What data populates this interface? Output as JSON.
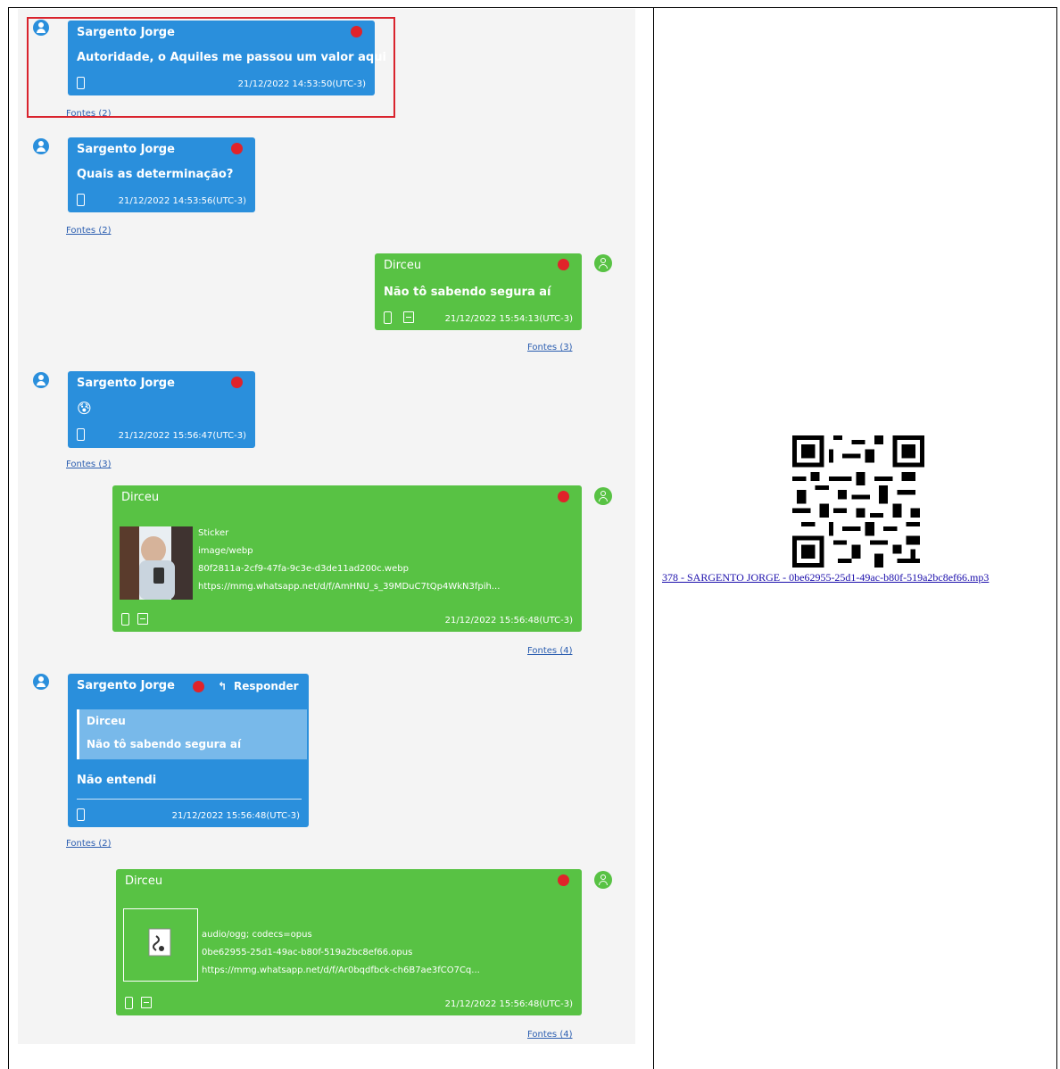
{
  "messages": [
    {
      "sender": "Sargento Jorge",
      "text": "Autoridade, o Aquiles me passou um valor aqui",
      "timestamp": "21/12/2022 14:53:50(UTC-3)",
      "sources": "Fontes (2)"
    },
    {
      "sender": "Sargento Jorge",
      "text": "Quais as determinação?",
      "timestamp": "21/12/2022 14:53:56(UTC-3)",
      "sources": "Fontes (2)"
    },
    {
      "sender": "Dirceu",
      "text": "Não tô sabendo segura aí",
      "timestamp": "21/12/2022 15:54:13(UTC-3)",
      "sources": "Fontes (3)"
    },
    {
      "sender": "Sargento Jorge",
      "text": "😰",
      "timestamp": "21/12/2022 15:56:47(UTC-3)",
      "sources": "Fontes (3)"
    },
    {
      "sender": "Dirceu",
      "file_type": "Sticker",
      "mime": "image/webp",
      "filename": "80f2811a-2cf9-47fa-9c3e-d3de11ad200c.webp",
      "url": "https://mmg.whatsapp.net/d/f/AmHNU_s_39MDuC7tQp4WkN3fpih...",
      "timestamp": "21/12/2022 15:56:48(UTC-3)",
      "sources": "Fontes (4)"
    },
    {
      "sender": "Sargento Jorge",
      "reply_label": "Responder",
      "quote_sender": "Dirceu",
      "quote_text": "Não tô sabendo segura aí",
      "text": "Não entendi",
      "timestamp": "21/12/2022 15:56:48(UTC-3)",
      "sources": "Fontes (2)"
    },
    {
      "sender": "Dirceu",
      "mime": "audio/ogg; codecs=opus",
      "filename": "0be62955-25d1-49ac-b80f-519a2bc8ef66.opus",
      "url": "https://mmg.whatsapp.net/d/f/Ar0bqdfbck-ch6B7ae3fCO7Cq...",
      "timestamp": "21/12/2022 15:56:48(UTC-3)",
      "sources": "Fontes (4)"
    }
  ],
  "attachment": {
    "link_text": "378 - SARGENTO JORGE - 0be62955-25d1-49ac-b80f-519a2bc8ef66.mp3"
  },
  "colors": {
    "incoming": "#2a8fdc",
    "outgoing": "#58c244",
    "status_dot": "#e0232a",
    "highlight": "#d9232d"
  },
  "icons": [
    "user-avatar-icon",
    "phone-device-icon",
    "save-icon",
    "reply-arrow-icon",
    "audio-file-icon",
    "qr-code-icon"
  ]
}
